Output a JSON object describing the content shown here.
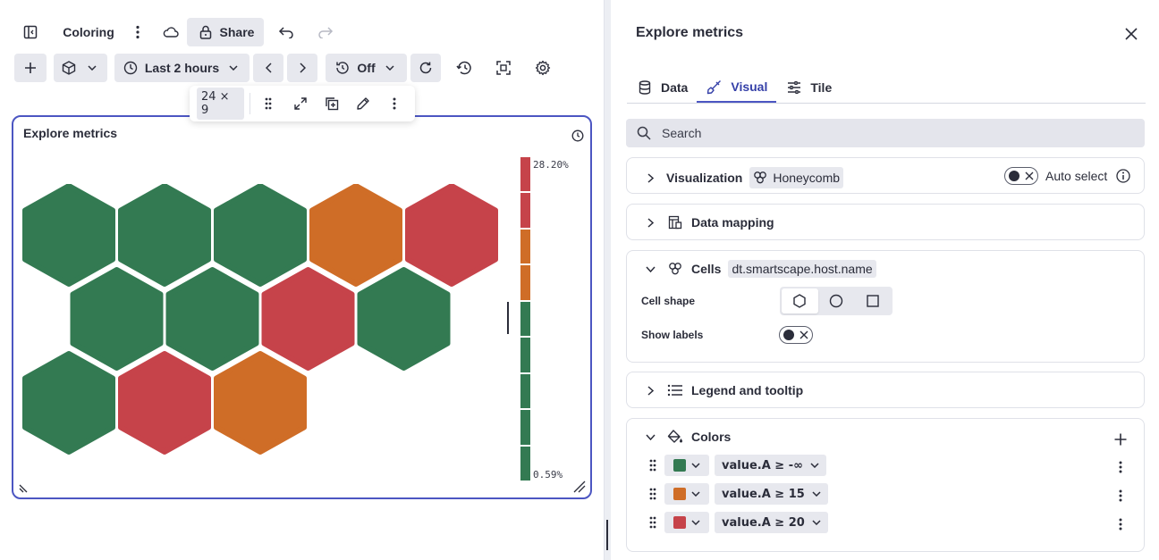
{
  "toolbar": {
    "dashboard_name": "Coloring",
    "share_label": "Share",
    "timeframe_label": "Last 2 hours",
    "refresh_label": "Off"
  },
  "tile_toolbar": {
    "size_label": "24 × 9"
  },
  "tile": {
    "title": "Explore metrics",
    "legend_max": "28.20%",
    "legend_min": "0.59%",
    "legend_colors": [
      "#c6434a",
      "#c6434a",
      "#cf6d27",
      "#cf6d27",
      "#337a52",
      "#337a52",
      "#337a52",
      "#337a52",
      "#337a52"
    ]
  },
  "cells": {
    "colors": {
      "green": "#337a52",
      "orange": "#cf6d27",
      "red": "#c6434a"
    },
    "rows": [
      [
        "green",
        "green",
        "green",
        "orange",
        "red"
      ],
      [
        "green",
        "green",
        "red",
        "green"
      ],
      [
        "green",
        "red",
        "orange"
      ]
    ]
  },
  "panel": {
    "title": "Explore metrics",
    "tabs": [
      {
        "label": "Data",
        "icon": "database-icon"
      },
      {
        "label": "Visual",
        "icon": "brush-icon"
      },
      {
        "label": "Tile",
        "icon": "sliders-icon"
      }
    ],
    "search_placeholder": "Search",
    "visualization": {
      "label": "Visualization",
      "value": "Honeycomb",
      "auto_select": "Auto select"
    },
    "data_mapping": {
      "label": "Data mapping"
    },
    "cells_section": {
      "label": "Cells",
      "field": "dt.smartscape.host.name",
      "cell_shape_label": "Cell shape",
      "show_labels_label": "Show labels"
    },
    "legend_section": {
      "label": "Legend and tooltip"
    },
    "colors_section": {
      "label": "Colors",
      "rules": [
        {
          "color": "#337a52",
          "condition": "value.A ≥ -∞"
        },
        {
          "color": "#cf6d27",
          "condition": "value.A ≥ 15"
        },
        {
          "color": "#c6434a",
          "condition": "value.A ≥ 20"
        }
      ]
    }
  }
}
